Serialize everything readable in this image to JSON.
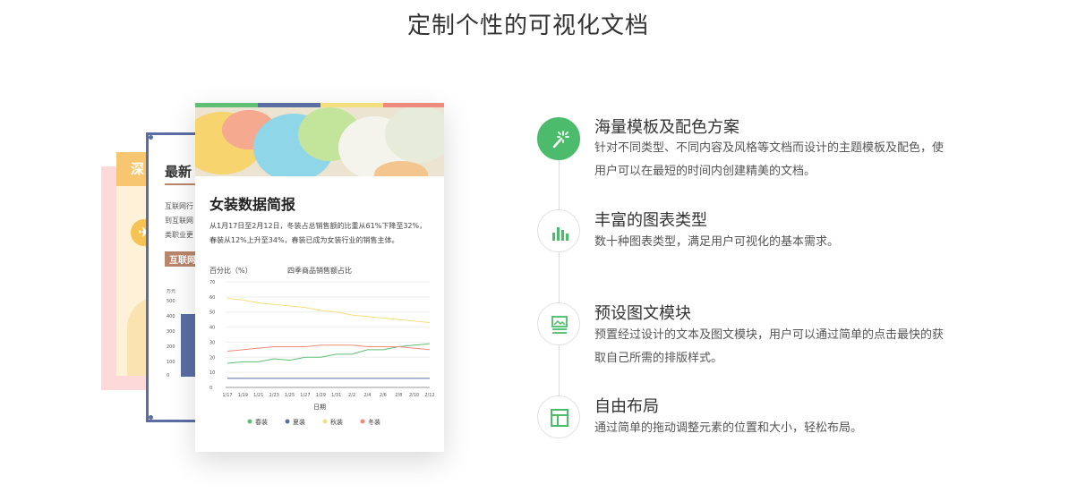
{
  "page_title": "定制个性的可视化文档",
  "back_card": {
    "heading": "深",
    "circle_glyph": "✈"
  },
  "mid_card": {
    "title": "最新",
    "lines": [
      "互联网行",
      "到互联网",
      "类职业更"
    ],
    "tag": "互联网",
    "axis_unit": "万元",
    "ticks": [
      "500",
      "400",
      "300",
      "200",
      "100",
      "0"
    ]
  },
  "doc": {
    "title": "女装数据简报",
    "body": "从1月17日至2月12日，冬装占总销售额的比重从61%下降至32%，春装从12%上升至34%，春装已成为女装行业的销售主体。",
    "stripe_colors": [
      "#5fbf74",
      "#5b6ea3",
      "#f4df80",
      "#ee8b7d"
    ]
  },
  "chart_data": {
    "type": "line",
    "title": "四季商品销售额占比",
    "ylabel": "百分比（%）",
    "xlabel": "日期",
    "ylim": [
      0,
      70
    ],
    "yticks": [
      "70",
      "60",
      "50",
      "40",
      "30",
      "20",
      "10",
      "0"
    ],
    "x": [
      "1/17",
      "1/19",
      "1/21",
      "1/23",
      "1/25",
      "1/27",
      "1/29",
      "1/31",
      "2/2",
      "2/4",
      "2/6",
      "2/8",
      "2/10",
      "2/12"
    ],
    "series": [
      {
        "name": "春装",
        "color": "#5fbf74",
        "values": [
          16,
          17,
          17,
          19,
          18,
          20,
          20,
          22,
          22,
          25,
          25,
          27,
          28,
          29
        ]
      },
      {
        "name": "夏装",
        "color": "#5b6ea3",
        "values": [
          6,
          6,
          6,
          6,
          6,
          6,
          6,
          6,
          6,
          6,
          6,
          6,
          6,
          6
        ]
      },
      {
        "name": "秋装",
        "color": "#f4df80",
        "values": [
          59,
          58,
          56,
          55,
          54,
          53,
          51,
          50,
          48,
          47,
          46,
          45,
          44,
          43
        ]
      },
      {
        "name": "冬装",
        "color": "#ee8b7d",
        "values": [
          24,
          25,
          26,
          27,
          27,
          27,
          28,
          28,
          28,
          27,
          27,
          27,
          26,
          25
        ]
      }
    ]
  },
  "features": [
    {
      "icon": "magic-wand-icon",
      "title": "海量模板及配色方案",
      "desc": "针对不同类型、不同内容及风格等文档而设计的主题模板及配色，使用户可以在最短的时间内创建精美的文档。"
    },
    {
      "icon": "bar-chart-icon",
      "title": "丰富的图表类型",
      "desc": "数十种图表类型，满足用户可视化的基本需求。"
    },
    {
      "icon": "image-text-icon",
      "title": "预设图文模块",
      "desc": "预置经过设计的文本及图文模块，用户可以通过简单的点击最快的获取自己所需的排版样式。"
    },
    {
      "icon": "layout-icon",
      "title": "自由布局",
      "desc": "通过简单的拖动调整元素的位置和大小，轻松布局。"
    }
  ],
  "colors": {
    "accent": "#4cbc6c",
    "icon_inactive": "#4cbc6c"
  }
}
